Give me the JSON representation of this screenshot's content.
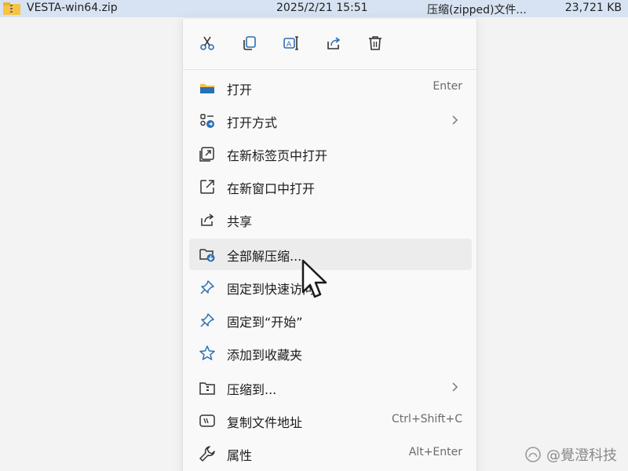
{
  "file_row": {
    "name": "VESTA-win64.zip",
    "date": "2025/2/21 15:51",
    "type": "压缩(zipped)文件...",
    "size": "23,721 KB"
  },
  "quick_actions": [
    "cut",
    "copy",
    "rename",
    "share",
    "delete"
  ],
  "menu_items": [
    {
      "label": "打开",
      "shortcut": "Enter",
      "icon": "folder-icon"
    },
    {
      "label": "打开方式",
      "submenu": true,
      "icon": "open-with-icon"
    },
    {
      "label": "在新标签页中打开",
      "icon": "new-tab-icon"
    },
    {
      "label": "在新窗口中打开",
      "icon": "new-window-icon"
    },
    {
      "label": "共享",
      "icon": "share-icon"
    },
    {
      "label": "全部解压缩...",
      "icon": "extract-icon",
      "hovered": true
    },
    {
      "label": "固定到快速访问",
      "icon": "pin-icon"
    },
    {
      "label": "固定到“开始”",
      "icon": "pin-icon"
    },
    {
      "label": "添加到收藏夹",
      "icon": "star-icon"
    },
    {
      "label": "压缩到...",
      "submenu": true,
      "icon": "compress-icon"
    },
    {
      "label": "复制文件地址",
      "shortcut": "Ctrl+Shift+C",
      "icon": "copy-path-icon"
    },
    {
      "label": "属性",
      "shortcut": "Alt+Enter",
      "icon": "wrench-icon"
    }
  ],
  "watermark": "@覺澄科技",
  "colors": {
    "accent": "#2b6fb5",
    "selection_row": "#d7e3f2",
    "menu_bg": "#f9f9f9",
    "hover_bg": "#ececec",
    "folder_yellow": "#f6c344"
  }
}
